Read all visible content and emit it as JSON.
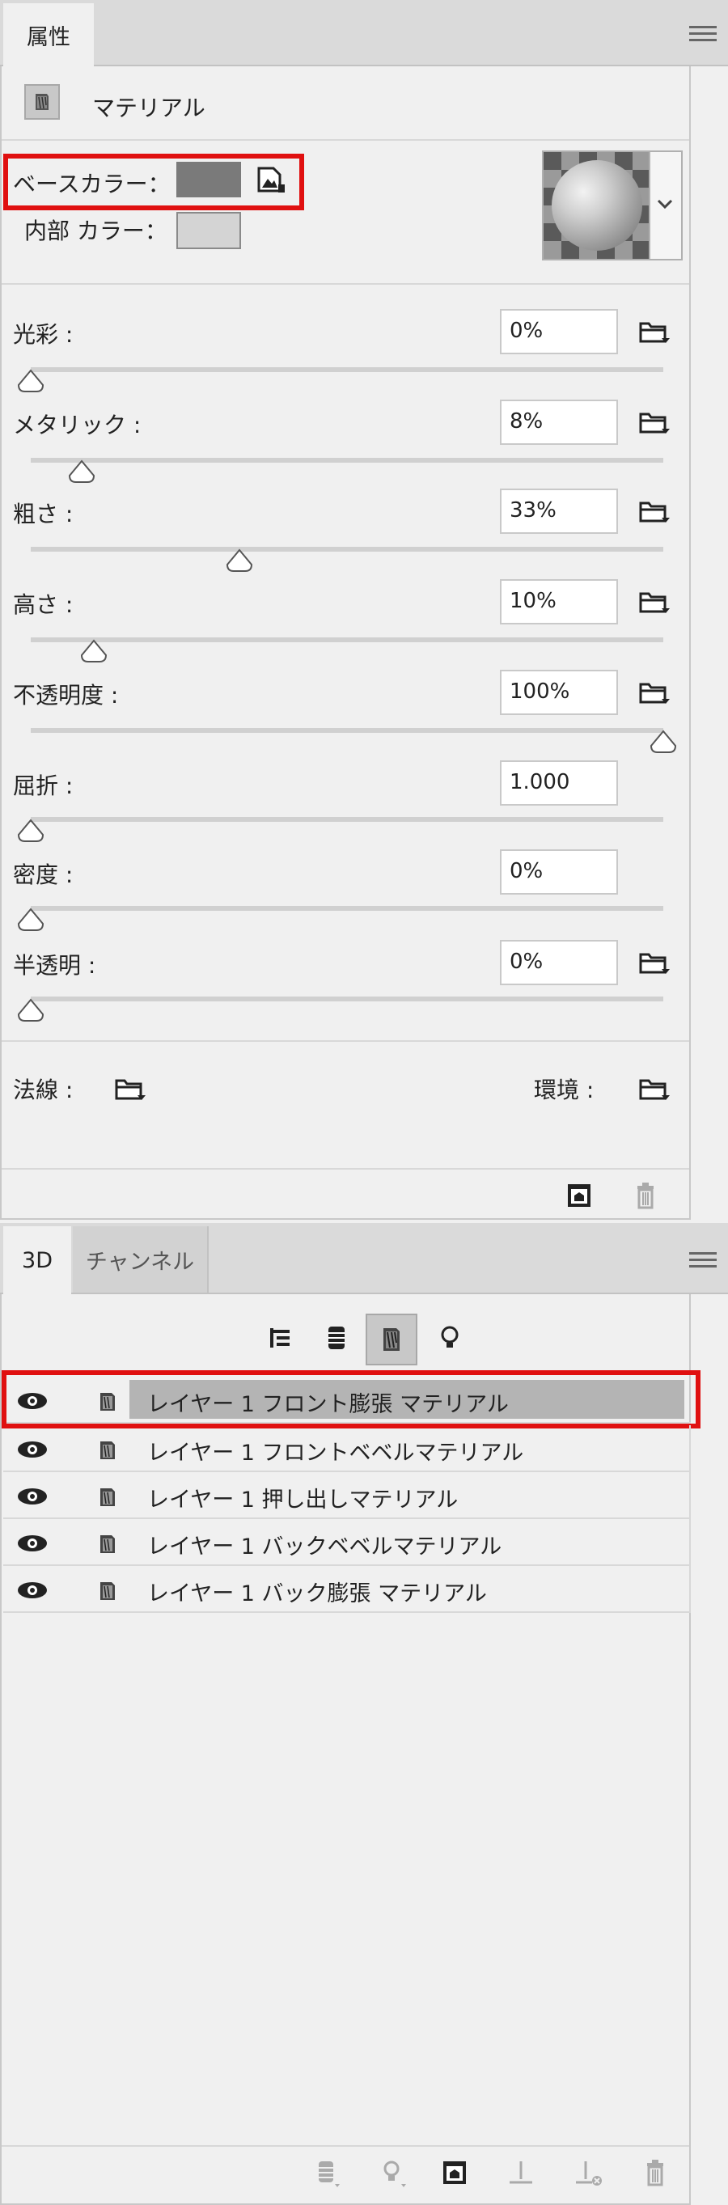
{
  "properties_panel": {
    "tab_label": "属性",
    "header_title": "マテリアル",
    "base_color_label": "ベースカラー：",
    "base_color": "#7a7a7a",
    "inner_color_label": "内部 カラー：",
    "inner_color": "#d4d4d4",
    "sliders": [
      {
        "label": "光彩 :",
        "value": "0%",
        "level": 0.0,
        "has_folder": true
      },
      {
        "label": "メタリック :",
        "value": "8%",
        "level": 0.08,
        "has_folder": true
      },
      {
        "label": "粗さ :",
        "value": "33%",
        "level": 0.33,
        "has_folder": true
      },
      {
        "label": "高さ :",
        "value": "10%",
        "level": 0.1,
        "has_folder": true
      },
      {
        "label": "不透明度 :",
        "value": "100%",
        "level": 1.0,
        "has_folder": true
      },
      {
        "label": "屈折 :",
        "value": "1.000",
        "level": 0.0,
        "has_folder": false
      },
      {
        "label": "密度 :",
        "value": "0%",
        "level": 0.0,
        "has_folder": false
      },
      {
        "label": "半透明 :",
        "value": "0%",
        "level": 0.0,
        "has_folder": true
      }
    ],
    "normal_label": "法線 :",
    "environment_label": "環境 :"
  },
  "three_d_panel": {
    "tabs": [
      "3D",
      "チャンネル"
    ],
    "layers": [
      {
        "name": "レイヤー 1 フロント膨張 マテリアル",
        "selected": true
      },
      {
        "name": "レイヤー 1 フロントベベルマテリアル",
        "selected": false
      },
      {
        "name": "レイヤー 1 押し出しマテリアル",
        "selected": false
      },
      {
        "name": "レイヤー 1 バックベベルマテリアル",
        "selected": false
      },
      {
        "name": "レイヤー 1 バック膨張 マテリアル",
        "selected": false
      }
    ]
  },
  "colors": {
    "highlight_red": "#e01010",
    "selected_row": "#b4b4b4",
    "panel_bg": "#f0f0f0"
  }
}
